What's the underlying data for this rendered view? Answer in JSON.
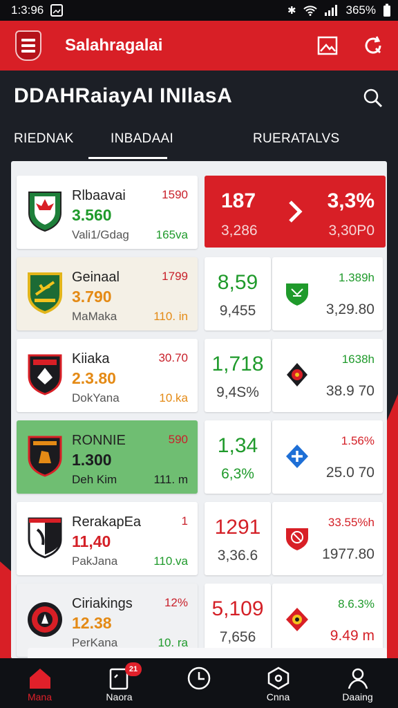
{
  "colors": {
    "brand_red": "#d81f26",
    "green": "#1f9a2b",
    "orange": "#e48a15",
    "red_text": "#d42027",
    "highlight_row": "#6fbe72"
  },
  "status_bar": {
    "time": "1:3:96",
    "battery": "365%",
    "icons": [
      "screenshot-icon",
      "bluetooth-icon",
      "wifi-icon",
      "signal-icon",
      "battery-icon"
    ]
  },
  "app_bar": {
    "title": "Salahragalai",
    "actions": [
      "image-icon",
      "refresh-icon"
    ]
  },
  "header": {
    "title": "DDAHRaiayAI INIlasA"
  },
  "tabs": [
    "RIEDNAK",
    "INBADAAI",
    "RUERATALVS"
  ],
  "teams": [
    {
      "name": "Rlbaavai",
      "score": "3.560",
      "sub": "Vali1/Gdag",
      "right_top": "1590",
      "right_bot": "165va",
      "score_color": "green"
    },
    {
      "name": "Geinaal",
      "score": "3.790",
      "sub": "MaMaka",
      "right_top": "1799",
      "right_bot": "110. in",
      "score_color": "orange"
    },
    {
      "name": "Kiiaka",
      "score": "2.3.80",
      "sub": "DokYana",
      "right_top": "30.70",
      "right_bot": "10.ka",
      "score_color": "orange"
    },
    {
      "name": "RONNIE",
      "score": "1.300",
      "sub": "Deh Kim",
      "right_top": "590",
      "right_bot": "111. m",
      "score_color": "dark"
    },
    {
      "name": "RerakapEa",
      "score": "11,40",
      "sub": "PakJana",
      "right_top": "1",
      "right_bot": "110.va",
      "score_color": "red"
    },
    {
      "name": "Ciriakings",
      "score": "12.38",
      "sub": "PerKana",
      "right_top": "12%",
      "right_bot": "10. ra",
      "score_color": "orange"
    }
  ],
  "featured": {
    "top_left": "187",
    "bottom_left": "3,286",
    "top_right": "3,3%",
    "bottom_right": "3,30P0"
  },
  "markets": [
    {
      "mid_top": "8,59",
      "mid_bot": "9,455",
      "right_top": "1.389h",
      "right_bot": "3,29.80",
      "icon": "shield-icon"
    },
    {
      "mid_top": "1,718",
      "mid_bot": "9,4S%",
      "right_top": "1638h",
      "right_bot": "38.9 70",
      "icon": "badge-icon"
    },
    {
      "mid_top": "1,34",
      "mid_bot": "6,3%",
      "right_top": "1.56%",
      "right_bot": "25.0 70",
      "icon": "plus-icon"
    },
    {
      "mid_top": "1291",
      "mid_bot": "3,36.6",
      "right_top": "33.55%h",
      "right_bot": "1977.80",
      "icon": "lion-icon"
    },
    {
      "mid_top": "5,109",
      "mid_bot": "7,656",
      "right_top": "8.6.3%",
      "right_bot": "9.49 m",
      "icon": "crest-icon"
    }
  ],
  "bottom_nav": [
    {
      "label": "Mana",
      "icon": "home-icon",
      "active": true
    },
    {
      "label": "Naora",
      "icon": "note-icon",
      "badge": "21"
    },
    {
      "label": "",
      "icon": "clock-icon"
    },
    {
      "label": "Cnna",
      "icon": "hexagon-icon"
    },
    {
      "label": "Daaing",
      "icon": "user-icon"
    }
  ]
}
